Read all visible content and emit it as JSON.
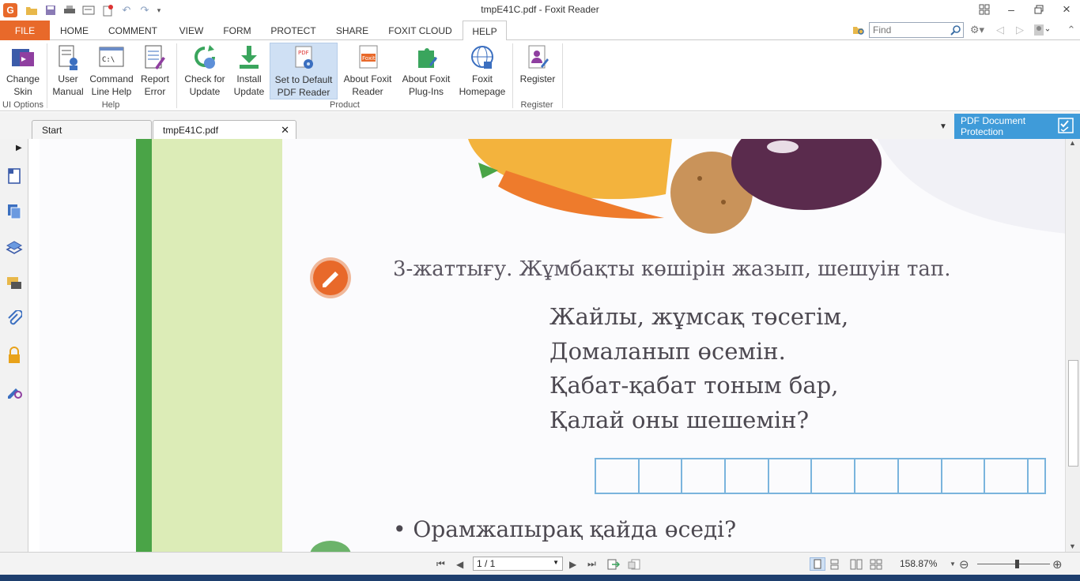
{
  "window": {
    "title": "tmpE41C.pdf - Foxit Reader"
  },
  "menu_tabs": [
    "FILE",
    "HOME",
    "COMMENT",
    "VIEW",
    "FORM",
    "PROTECT",
    "SHARE",
    "FOXIT CLOUD",
    "HELP"
  ],
  "search": {
    "placeholder": "Find"
  },
  "ribbon": {
    "buttons": [
      {
        "l1": "Change",
        "l2": "Skin"
      },
      {
        "l1": "User",
        "l2": "Manual"
      },
      {
        "l1": "Command",
        "l2": "Line Help"
      },
      {
        "l1": "Report",
        "l2": "Error"
      },
      {
        "l1": "Check for",
        "l2": "Update"
      },
      {
        "l1": "Install",
        "l2": "Update"
      },
      {
        "l1": "Set to Default",
        "l2": "PDF Reader"
      },
      {
        "l1": "About Foxit",
        "l2": "Reader"
      },
      {
        "l1": "About Foxit",
        "l2": "Plug-Ins"
      },
      {
        "l1": "Foxit",
        "l2": "Homepage"
      },
      {
        "l1": "Register",
        "l2": ""
      }
    ],
    "groups": [
      "UI Options",
      "Help",
      "Product",
      "Register"
    ]
  },
  "doc_tabs": [
    "Start",
    "tmpE41C.pdf"
  ],
  "protection_panel": {
    "l1": "PDF Document",
    "l2": "Protection"
  },
  "document": {
    "exercise_title": "3-жаттығу. Жұмбақты көшірін жазып, шешуін тап.",
    "poem": [
      "Жайлы, жұмсақ төсегім,",
      "Домаланып өсемін.",
      "Қабат-қабат тоным бар,",
      "Қалай оны шешемін?"
    ],
    "question": "• Орамжапырақ қайда өседі?"
  },
  "status": {
    "page": "1 / 1",
    "zoom": "158.87%"
  },
  "colors": {
    "accent": "#e8692a",
    "protect": "#3f9bd9",
    "selected": "#cfe0f4"
  }
}
